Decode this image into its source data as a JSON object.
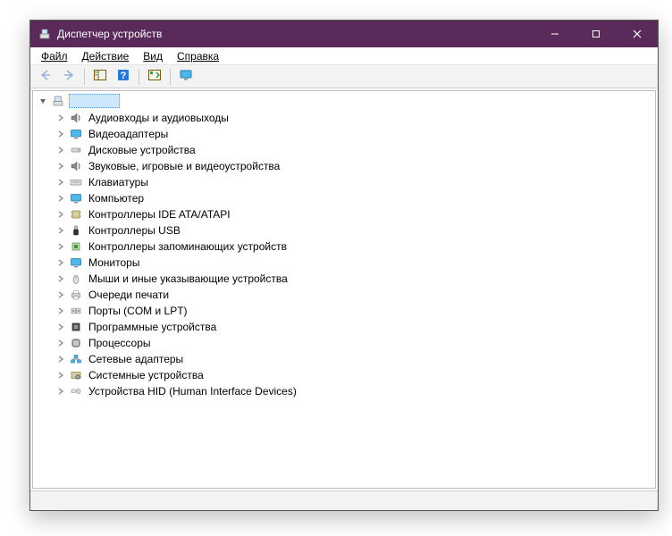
{
  "window": {
    "title": "Диспетчер устройств"
  },
  "menu": {
    "file": "Файл",
    "action": "Действие",
    "view": "Вид",
    "help": "Справка"
  },
  "root": {
    "label": "——————"
  },
  "categories": [
    {
      "id": "audio",
      "label": "Аудиовходы и аудиовыходы"
    },
    {
      "id": "display",
      "label": "Видеоадаптеры"
    },
    {
      "id": "disk",
      "label": "Дисковые устройства"
    },
    {
      "id": "sound",
      "label": "Звуковые, игровые и видеоустройства"
    },
    {
      "id": "keyboard",
      "label": "Клавиатуры"
    },
    {
      "id": "computer",
      "label": "Компьютер"
    },
    {
      "id": "ide",
      "label": "Контроллеры IDE ATA/ATAPI"
    },
    {
      "id": "usb",
      "label": "Контроллеры USB"
    },
    {
      "id": "storage",
      "label": "Контроллеры запоминающих устройств"
    },
    {
      "id": "monitor",
      "label": "Мониторы"
    },
    {
      "id": "mouse",
      "label": "Мыши и иные указывающие устройства"
    },
    {
      "id": "printq",
      "label": "Очереди печати"
    },
    {
      "id": "ports",
      "label": "Порты (COM и LPT)"
    },
    {
      "id": "software",
      "label": "Программные устройства"
    },
    {
      "id": "cpu",
      "label": "Процессоры"
    },
    {
      "id": "network",
      "label": "Сетевые адаптеры"
    },
    {
      "id": "system",
      "label": "Системные устройства"
    },
    {
      "id": "hid",
      "label": "Устройства HID (Human Interface Devices)"
    }
  ],
  "icons": {
    "audio": "speaker",
    "display": "monitor-blue",
    "disk": "drive",
    "sound": "speaker",
    "keyboard": "keyboard",
    "computer": "monitor-blue",
    "ide": "chip",
    "usb": "usb",
    "storage": "chip-green",
    "monitor": "monitor-blue",
    "mouse": "mouse",
    "printq": "printer",
    "ports": "port",
    "software": "chip-dark",
    "cpu": "cpu",
    "network": "network",
    "system": "gear-board",
    "hid": "hid"
  }
}
